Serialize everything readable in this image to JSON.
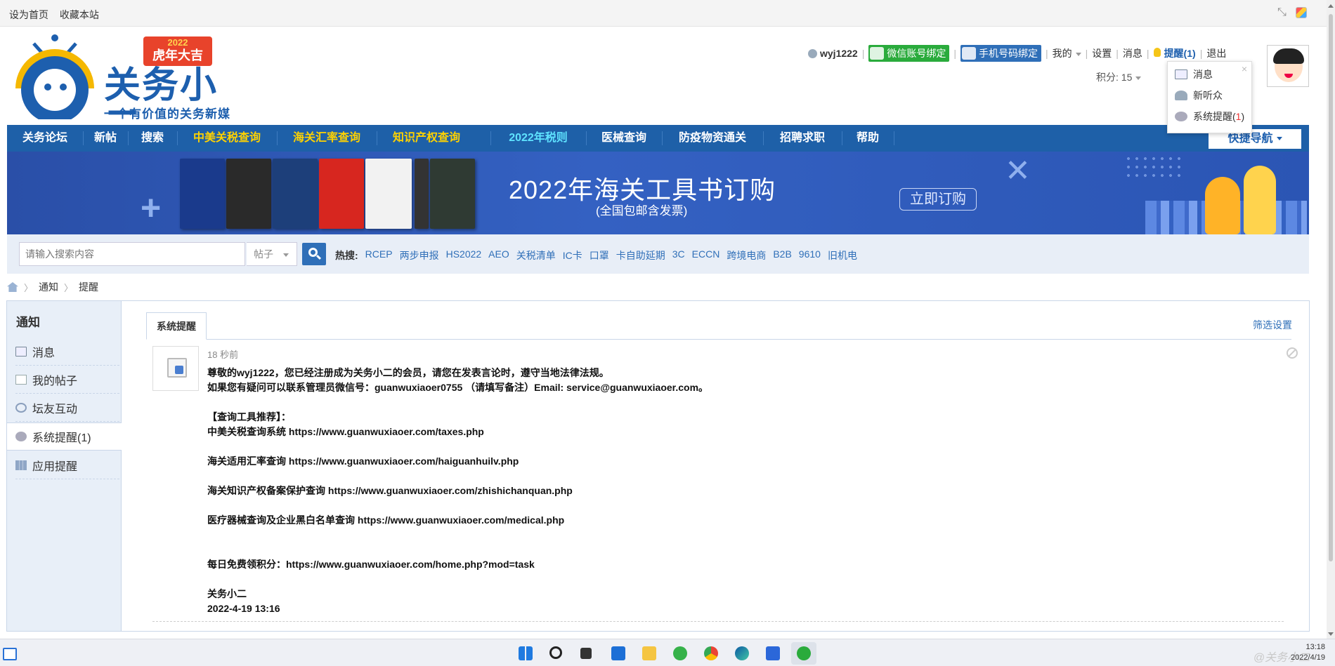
{
  "topbar": {
    "set_home": "设为首页",
    "favorite": "收藏本站"
  },
  "logo": {
    "year": "2022",
    "banner_text": "虎年大吉",
    "name": "关务小二",
    "slogan": "一个有价值的关务新媒体"
  },
  "user": {
    "username": "wyj1222",
    "wechat_bind": "微信账号绑定",
    "phone_bind": "手机号码绑定",
    "mine": "我的",
    "settings": "设置",
    "messages": "消息",
    "reminders": "提醒(1)",
    "logout": "退出",
    "credits": "积分: 15"
  },
  "dropdown": {
    "messages": "消息",
    "new_listener": "新听众",
    "system_reminder_label": "系统提醒(",
    "system_reminder_count": "1",
    "system_reminder_close": ")"
  },
  "nav": {
    "items": [
      "关务论坛",
      "新帖",
      "搜索",
      "中美关税查询",
      "海关汇率查询",
      "知识产权查询",
      "2022年税则",
      "医械查询",
      "防疫物资通关",
      "招聘求职",
      "帮助"
    ],
    "quick_nav": "快捷导航"
  },
  "banner": {
    "title": "2022年海关工具书订购",
    "subtitle": "(全国包邮含发票)",
    "order_button": "立即订购"
  },
  "search": {
    "placeholder": "请输入搜索内容",
    "type": "帖子",
    "hot_label": "热搜:",
    "hot_keywords": [
      "RCEP",
      "两步申报",
      "HS2022",
      "AEO",
      "关税清单",
      "IC卡",
      "口罩",
      "卡自助延期",
      "3C",
      "ECCN",
      "跨境电商",
      "B2B",
      "9610",
      "旧机电"
    ]
  },
  "breadcrumb": {
    "level1": "通知",
    "level2": "提醒"
  },
  "sidebar": {
    "title": "通知",
    "items": [
      "消息",
      "我的帖子",
      "坛友互动",
      "系统提醒(1)",
      "应用提醒"
    ]
  },
  "content": {
    "tab": "系统提醒",
    "filter": "筛选设置",
    "notice": {
      "time": "18 秒前",
      "lines": [
        "尊敬的wyj1222，您已经注册成为关务小二的会员，请您在发表言论时，遵守当地法律法规。",
        "如果您有疑问可以联系管理员微信号：guanwuxiaoer0755 （请填写备注）Email: service@guanwuxiaoer.com。",
        "",
        "【查询工具推荐】：",
        "中美关税查询系统 https://www.guanwuxiaoer.com/taxes.php",
        "",
        "海关适用汇率查询 https://www.guanwuxiaoer.com/haiguanhuilv.php",
        "",
        "海关知识产权备案保护查询 https://www.guanwuxiaoer.com/zhishichanquan.php",
        "",
        "医疗器械查询及企业黑白名单查询 https://www.guanwuxiaoer.com/medical.php",
        "",
        "",
        "每日免费领积分：https://www.guanwuxiaoer.com/home.php?mod=task",
        "",
        "关务小二",
        "2022-4-19 13:16"
      ]
    }
  },
  "taskbar": {
    "time": "13:18",
    "date": "2022/4/19",
    "watermark": "@关务小二"
  },
  "colors": {
    "nav_blue": "#1e60a8",
    "link_blue": "#2f6fb8",
    "nav_highlight": "#ffd200",
    "nav_cyan": "#5fe3ff"
  }
}
